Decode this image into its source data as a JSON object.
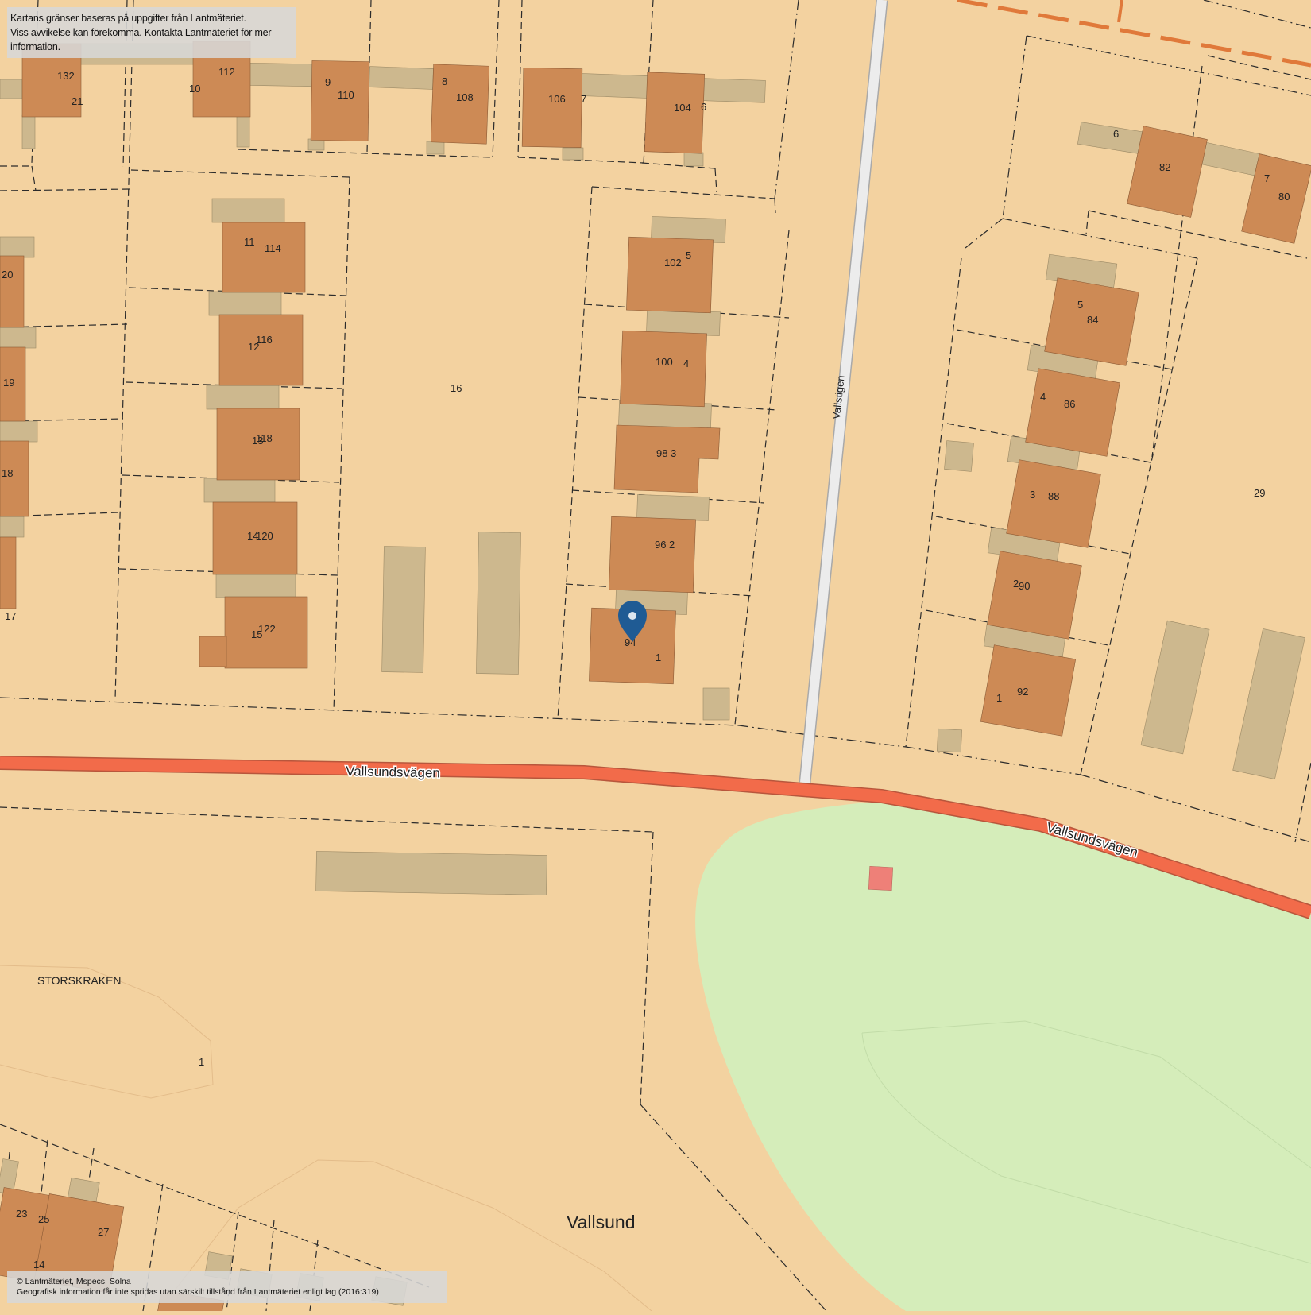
{
  "notices": {
    "top_line1": "Kartans gränser baseras på uppgifter från Lantmäteriet.",
    "top_line2": "Viss avvikelse kan förekomma. Kontakta Lantmäteriet för mer information.",
    "bottom_line1": "© Lantmäteriet, Mspecs, Solna",
    "bottom_line2": "Geografisk information får inte spridas utan särskilt tillstånd från Lantmäteriet enligt lag (2016:319)"
  },
  "roads": {
    "main_road_label_1": "Vallsundsvägen",
    "main_road_label_2": "Vallsundsvägen",
    "path_label": "Vallstigen"
  },
  "areas": {
    "district": "Vallsund",
    "block": "STORSKRAKEN",
    "block_number": "1",
    "parcel_16": "16",
    "parcel_29": "29"
  },
  "house_labels": [
    "132",
    "21",
    "112",
    "10",
    "9",
    "110",
    "8",
    "108",
    "106",
    "7",
    "104",
    "6",
    "11",
    "114",
    "12",
    "116",
    "13",
    "118",
    "14",
    "120",
    "15",
    "122",
    "20",
    "19",
    "18",
    "17",
    "102",
    "5",
    "100",
    "4",
    "98",
    "3",
    "96",
    "2",
    "94",
    "1",
    "6",
    "82",
    "7",
    "80",
    "5",
    "84",
    "4",
    "86",
    "3",
    "88",
    "2",
    "90",
    "1",
    "92",
    "23",
    "25",
    "27",
    "14"
  ],
  "marker": {
    "icon": "map-pin-icon",
    "color": "#1f5b94"
  },
  "colors": {
    "background": "#f3d2a0",
    "house": "#cd8a55",
    "garage": "#cdb88e",
    "main_road": "#f26b4a",
    "park": "#d5edba"
  }
}
